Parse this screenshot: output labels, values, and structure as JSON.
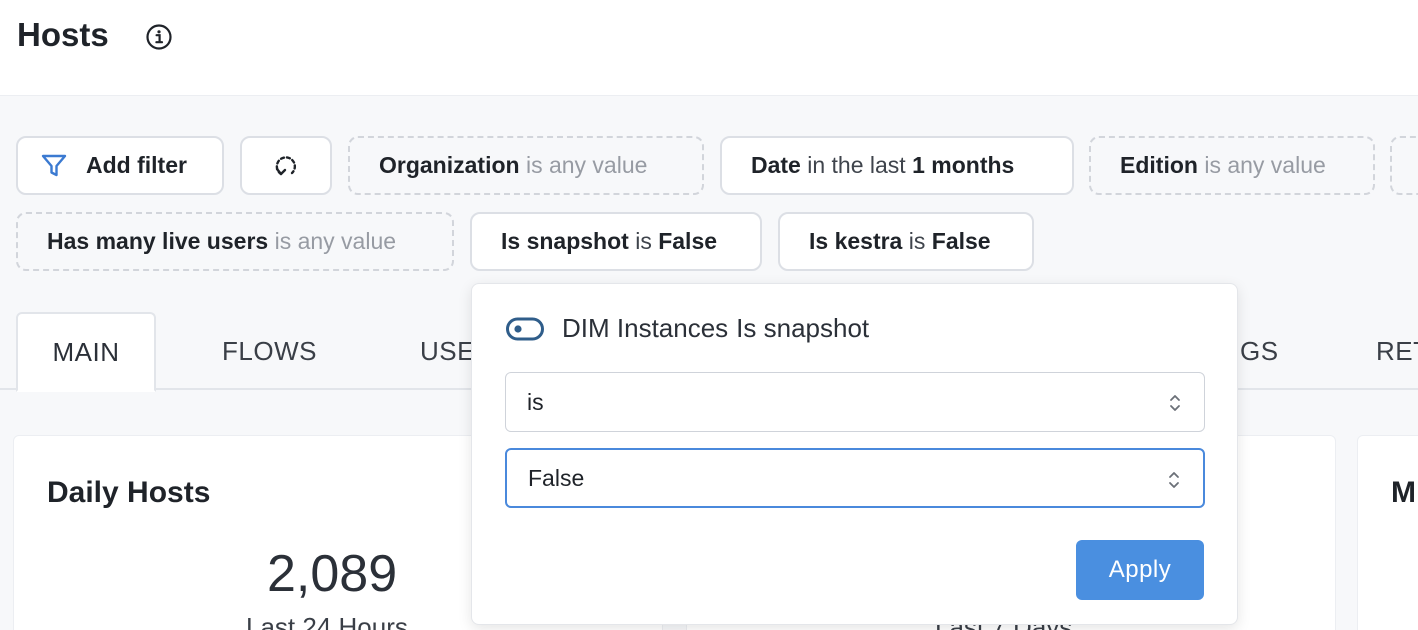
{
  "page": {
    "title": "Hosts"
  },
  "filters": {
    "add_filter_label": "Add filter",
    "chips": [
      {
        "key": "Organization",
        "mid": "is any value",
        "value": ""
      },
      {
        "key": "Date",
        "mid": "in the last",
        "value": "1 months"
      },
      {
        "key": "Edition",
        "mid": "is any value",
        "value": ""
      },
      {
        "key": "Has many live users",
        "mid": "is any value",
        "value": ""
      },
      {
        "key": "Is snapshot",
        "mid": "is",
        "value": "False"
      },
      {
        "key": "Is kestra",
        "mid": "is",
        "value": "False"
      }
    ]
  },
  "tabs": [
    "MAIN",
    "FLOWS",
    "USE",
    "GS",
    "RET"
  ],
  "cards": {
    "daily": {
      "title": "Daily Hosts",
      "value": "2,089",
      "subtitle": "Last 24 Hours"
    },
    "weekly": {
      "subtitle": "Last 7 Days"
    },
    "third": {
      "title": "M"
    }
  },
  "popover": {
    "source": "DIM Instances",
    "field": "Is snapshot",
    "operator_value": "is",
    "value_value": "False",
    "apply_label": "Apply"
  },
  "colors": {
    "accent": "#4a8fe0",
    "focus_border": "#4a89dc",
    "toggle": "#2f5d8a",
    "filter_icon": "#3b7ad1"
  }
}
